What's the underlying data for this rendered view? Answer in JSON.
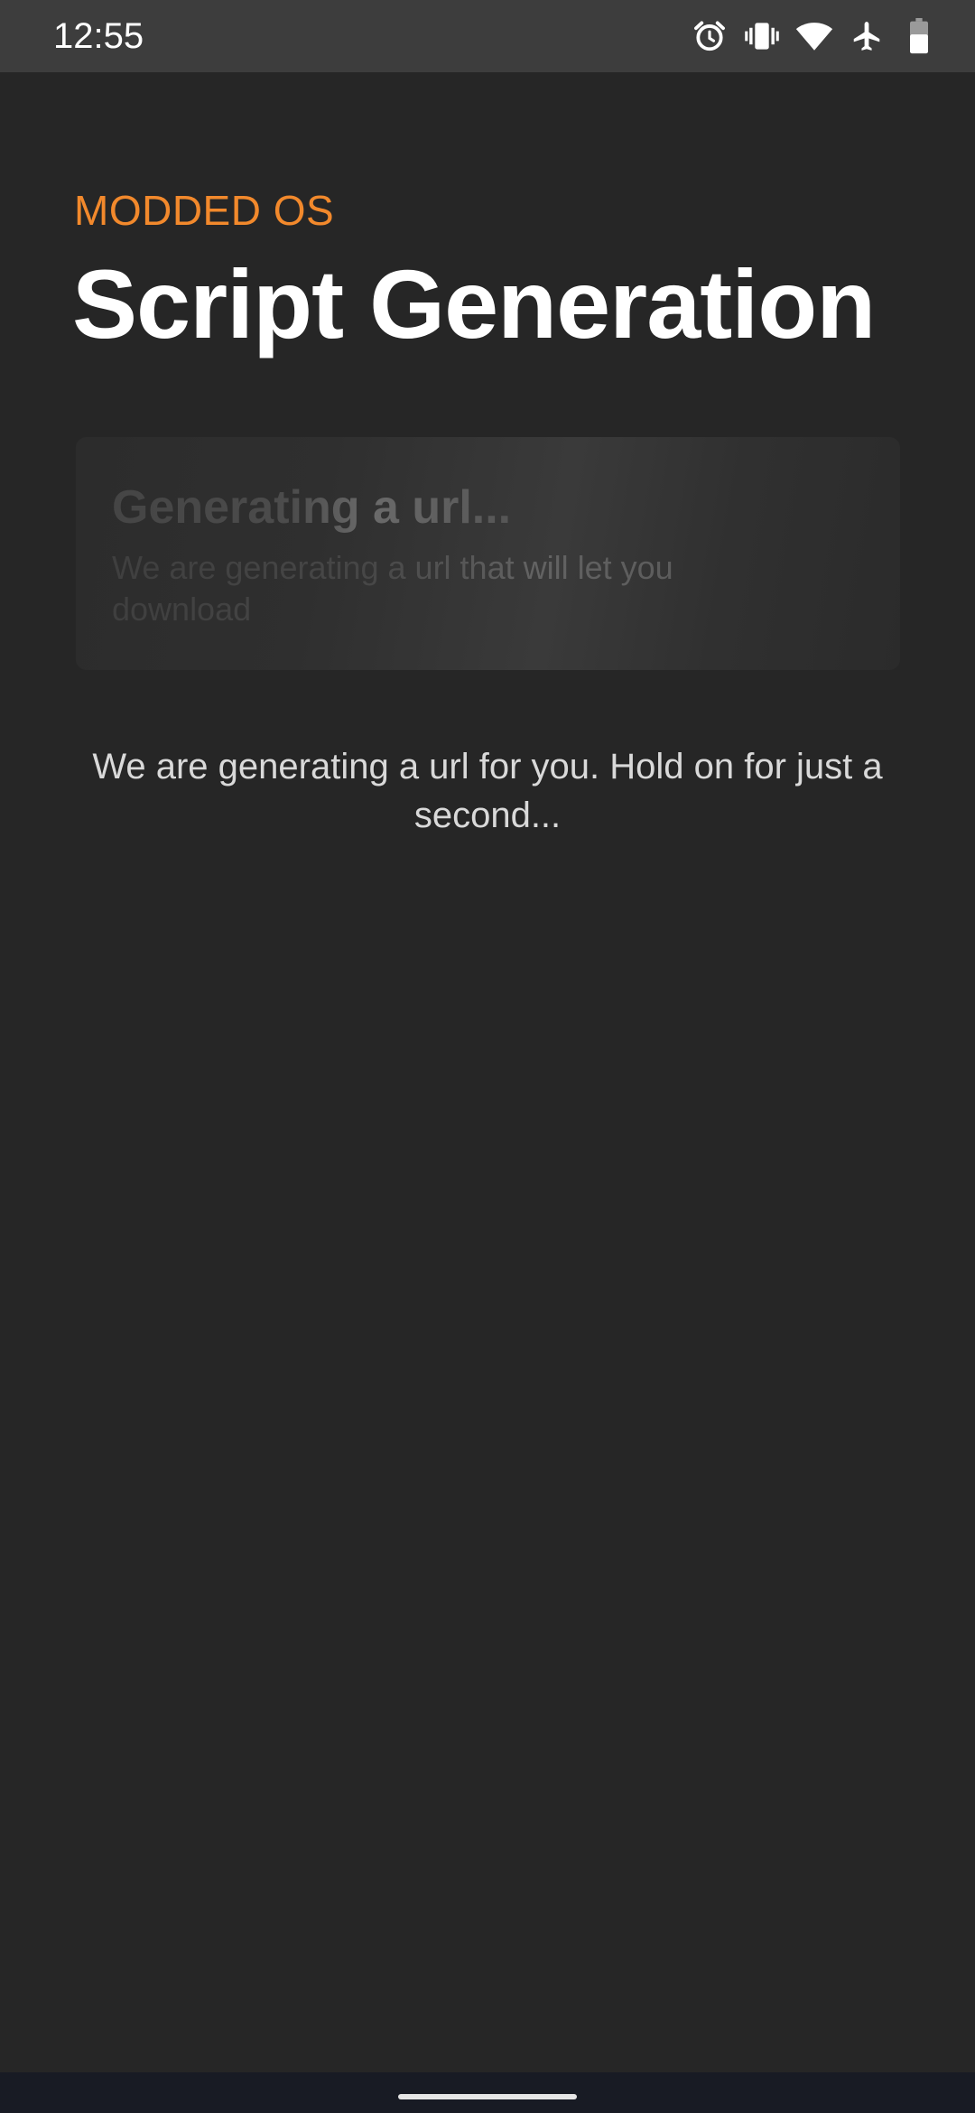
{
  "status_bar": {
    "time": "12:55",
    "icons": [
      "alarm-icon",
      "vibrate-icon",
      "wifi-icon",
      "airplane-mode-icon",
      "battery-icon"
    ]
  },
  "header": {
    "eyebrow": "MODDED OS",
    "title": "Script Generation"
  },
  "card": {
    "title": "Generating a url...",
    "body": "We are generating a url that will let you download"
  },
  "message": "We are generating a url for you. Hold on for just a second...",
  "colors": {
    "background": "#262626",
    "status_bar": "#3d3d3d",
    "accent": "#f2892c",
    "title": "#ffffff",
    "message": "#d9d9d9",
    "nav_bar": "#181b24"
  }
}
